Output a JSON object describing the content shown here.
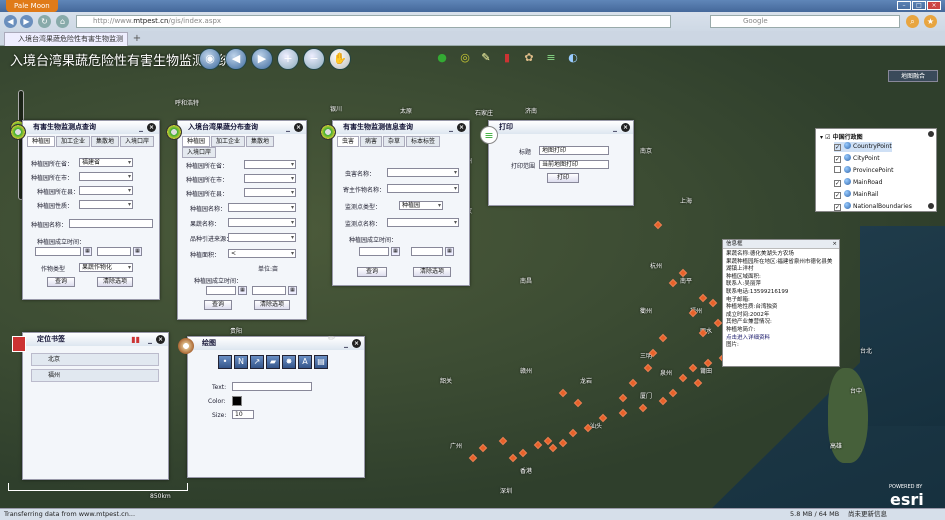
{
  "browser": {
    "app_button": "Pale Moon",
    "url_prefix": "http://www.",
    "url_domain": "mtpest.cn",
    "url_suffix": "/gis/index.aspx",
    "search_placeholder": "Google",
    "tab_title": "入境台湾果蔬危险性有害生物监测",
    "new_tab": "+"
  },
  "app": {
    "title": "入境台湾果蔬危险性有害生物监测系统"
  },
  "map_labels": {
    "legend_corner": "地图融合",
    "scale": "850km",
    "esri": "esri",
    "esri_powered": "POWERED BY"
  },
  "panel1": {
    "title": "有害生物监测点查询",
    "tabs": [
      "种植园",
      "加工企业",
      "集散地",
      "入境口岸"
    ],
    "f_county": "种植园所在省：",
    "f_county_val": "福建省",
    "f_city": "种植园所在市：",
    "f_town": "种植园所在县：",
    "f_type": "种植园性质：",
    "f_name": "种植园名称：",
    "f_time": "种植园成立时间：",
    "f_crop": "作物类型",
    "f_crop_val": "果蔬作物化",
    "query": "查询",
    "clear": "清除选项"
  },
  "panel2": {
    "title": "入境台湾果蔬分布查询",
    "tabs": [
      "种植园",
      "加工企业",
      "集散地",
      "入境口岸"
    ],
    "f1": "种植园所在省：",
    "f2": "种植园所在市：",
    "f3": "种植园所在县：",
    "f4": "种植园名称：",
    "f5": "果蔬名称：",
    "f6": "品种引进来源：",
    "f7": "种植面积：",
    "f7_val": "<",
    "unit": "单位:亩",
    "f8": "种植园成立时间：",
    "query": "查询",
    "clear": "清除选项"
  },
  "panel3": {
    "title": "有害生物监测信息查询",
    "tabs": [
      "虫害",
      "病害",
      "杂草",
      "标本标签"
    ],
    "f1": "虫害名称：",
    "f2": "寄主作物名称：",
    "f3": "监测点类型：",
    "f3_val": "种植园",
    "f4": "监测点名称：",
    "f5": "种植园成立时间：",
    "query": "查询",
    "clear": "清除选项"
  },
  "print": {
    "title": "打印",
    "label_title": "标题",
    "title_val": "地图打印",
    "label_note": "打印范围",
    "note_val": "当前地图打印",
    "button": "打印"
  },
  "legend": {
    "root": "中国行政图",
    "layers": [
      "CountryPoint",
      "CityPoint",
      "ProvincePoint",
      "MainRoad",
      "MainRail",
      "NationalBoundaries"
    ],
    "checked": [
      true,
      true,
      false,
      true,
      true,
      true
    ]
  },
  "popup": {
    "title": "信息框",
    "lines": [
      "果蔬名称:德化美湖头方农场",
      "果蔬种植园所在地区:福建省泉州市德化县美",
      "湖镇上洋村",
      "种植区域面积:",
      "联系人:吴丽萍",
      "联系电话:13599216199",
      "电子邮箱:",
      "种植地性质:台湾独资",
      "成立时间:2002年",
      "其他产业兼营情况:",
      "种植地简介:",
      "点击进入详细资料",
      "图片:"
    ]
  },
  "bookmark": {
    "title": "定位书签",
    "items": [
      "北京",
      "福州"
    ]
  },
  "draw": {
    "title": "绘图",
    "text_label": "Text:",
    "color_label": "Color:",
    "size_label": "Size:",
    "size_val": "10"
  },
  "cities": [
    "呼和浩特",
    "银川",
    "太原",
    "石家庄",
    "济南",
    "西宁",
    "兰州",
    "郑州",
    "西安",
    "合肥",
    "南京",
    "上海",
    "武汉",
    "成都",
    "重庆",
    "杭州",
    "长沙",
    "南昌",
    "福州",
    "台北",
    "贵阳",
    "昆明",
    "南宁",
    "广州",
    "香港",
    "海口",
    "台中",
    "高雄",
    "厦门",
    "泉州",
    "莆田",
    "汕头",
    "深圳",
    "韶关",
    "赣州",
    "温州",
    "宁波",
    "衢州",
    "丽水",
    "龙岩",
    "三明",
    "南平"
  ],
  "status": {
    "text": "Transferring data from www.mtpest.cn...",
    "memory": "5.8 MB / 64 MB",
    "right": "尚未更新信息"
  }
}
